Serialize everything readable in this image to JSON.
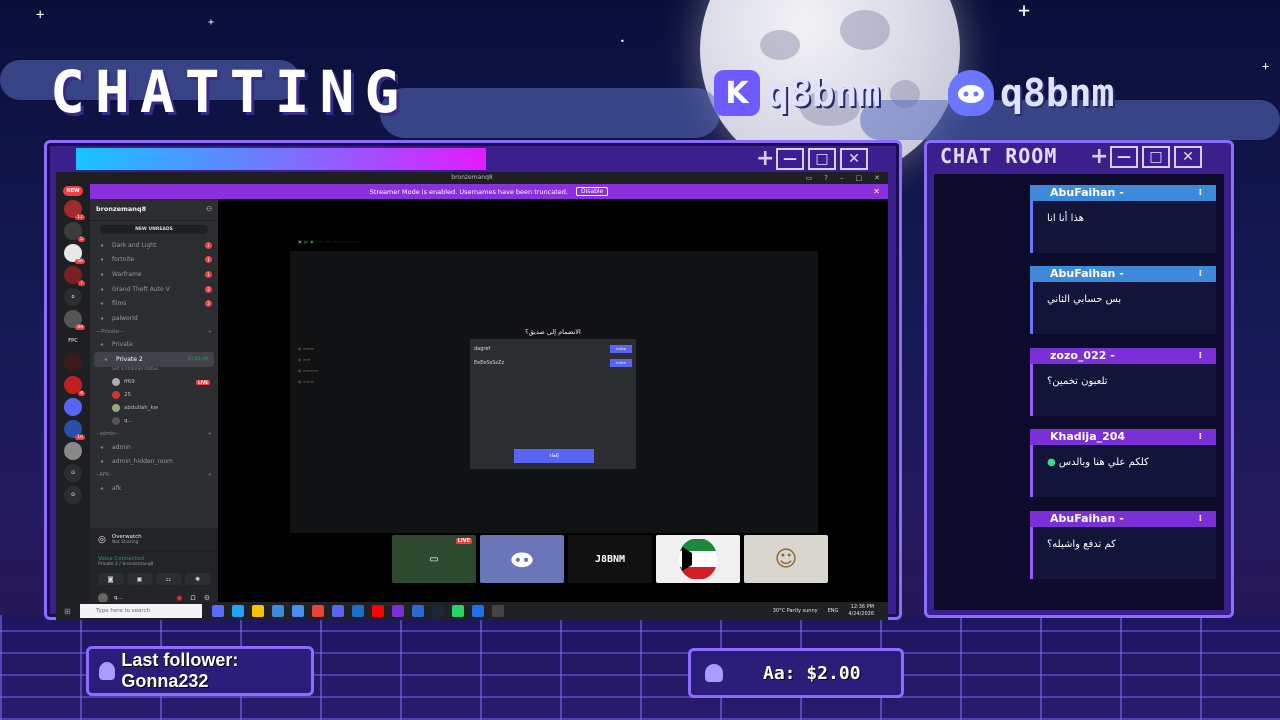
{
  "overlay": {
    "title": "CHATTING",
    "kick_handle": "q8bnm",
    "discord_handle": "q8bnm",
    "chat_room_title": "CHAT ROOM",
    "last_follower": "Last follower: Gonna232",
    "donation": "Aa: $2.00"
  },
  "discord": {
    "window_title": "bronzemanq8",
    "streamer_banner": "Streamer Mode is enabled. Usernames have been truncated.",
    "streamer_disable": "Disable",
    "guild_name": "bronzemanq8",
    "new_unreads": "NEW UNREADS",
    "channels": [
      {
        "name": "Dark and Light",
        "badge": "1"
      },
      {
        "name": "fortnite",
        "badge": "1"
      },
      {
        "name": "Warframe",
        "badge": "1"
      },
      {
        "name": "Grand Theft Auto V",
        "badge": "2"
      },
      {
        "name": "films",
        "badge": "2"
      },
      {
        "name": "palworld",
        "badge": ""
      }
    ],
    "private_category": "---Private---",
    "private_channel": "Private",
    "voice_channel": "Private 2",
    "voice_timer": "01:05:49",
    "voice_status": "Set a channel status",
    "members": [
      {
        "name": "ff69",
        "live": "LIVE"
      },
      {
        "name": "25",
        "live": ""
      },
      {
        "name": "abdullah_kw",
        "live": ""
      },
      {
        "name": "q...",
        "live": ""
      }
    ],
    "admin_category": "--admin--",
    "admin_channels": [
      "admin",
      "admin_hidden_room"
    ],
    "afk_category": "--AFK--",
    "afk_channel": "afk",
    "activity_name": "Overwatch",
    "activity_sub": "Not Sharing",
    "voice_connected": "Voice Connected",
    "voice_connected_sub": "Private 2 / bronzemanq8",
    "user_name": "q...",
    "modal_title": "الانضمام إلى صديق؟",
    "modal_rows": [
      {
        "name": "dagref",
        "button": "Invite"
      },
      {
        "name": "EeEeSsSsZz",
        "button": "Invite"
      }
    ],
    "modal_button": "إلغاء",
    "tile_live": "LIVE",
    "tile_brand": "J8BNM",
    "search_placeholder": "Type here to search",
    "weather": "30°C  Partly sunny",
    "lang": "ENG",
    "time": "12:36 PM",
    "date": "4/24/2026"
  },
  "chat_messages": [
    {
      "user": "AbuFaihan -",
      "text": "هذا أنا انا",
      "color": "#3d8bd8"
    },
    {
      "user": "AbuFaihan -",
      "text": "بس حسابي الثاني",
      "color": "#3d8bd8"
    },
    {
      "user": "zozo_022 -",
      "text": "تلعبون تخمين؟",
      "color": "#7b2fd6"
    },
    {
      "user": "Khadija_204",
      "text": "كلكم علي هنا وبالدس",
      "color": "#7b2fd6"
    },
    {
      "user": "AbuFaihan -",
      "text": "كم تدفع واشيله؟",
      "color": "#7b2fd6"
    }
  ],
  "colors": {
    "frame": "#3b1f8c",
    "frame_border": "#8e6cff",
    "streamer_bar": "#8c2fdc",
    "discord_blurple": "#5865f2",
    "kick_logo": "#6e5bff",
    "discord_logo": "#6b76ff"
  }
}
